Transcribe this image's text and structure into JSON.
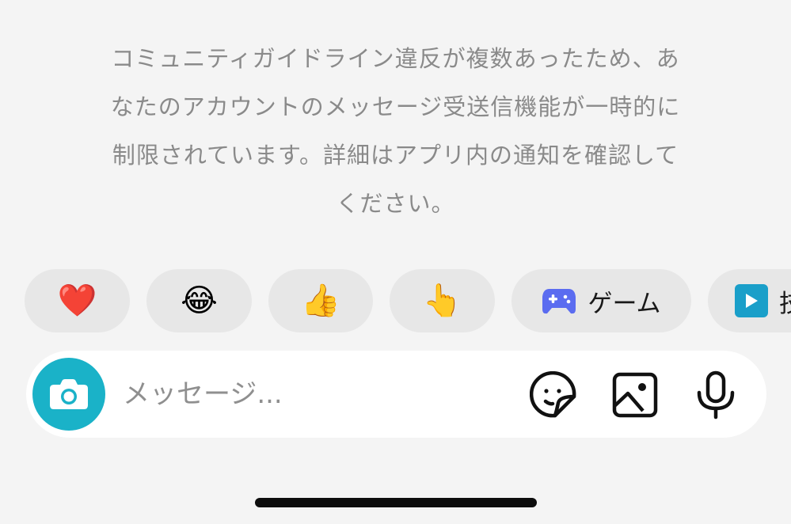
{
  "notice": {
    "lines": [
      "コミュニティガイドライン違反が複数あったため、あ",
      "なたのアカウントのメッセージ受送信機能が一時的に",
      "制限されています。詳細はアプリ内の通知を確認して",
      "ください。"
    ]
  },
  "quick_replies": [
    {
      "emoji": "❤️",
      "icon": "heart-icon"
    },
    {
      "emoji": "😂",
      "icon": "laughing-tears-icon"
    },
    {
      "emoji": "👍",
      "icon": "thumbs-up-icon"
    },
    {
      "emoji": "👆",
      "icon": "pointing-up-icon"
    },
    {
      "label": "ゲーム",
      "icon": "game-controller-icon",
      "icon_color": "#5b6cf0"
    },
    {
      "label": "技",
      "icon": "video-play-icon",
      "icon_color": "#1a9fc9"
    }
  ],
  "composer": {
    "placeholder": "メッセージ...",
    "camera_icon": "camera-icon",
    "camera_color": "#1ab2c8",
    "tools": [
      "sticker-icon",
      "image-icon",
      "microphone-icon"
    ]
  }
}
